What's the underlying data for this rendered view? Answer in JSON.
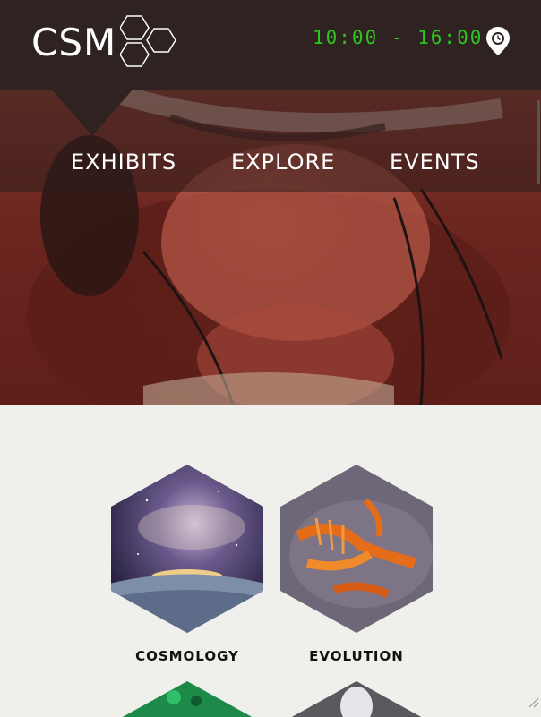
{
  "header": {
    "logo_text": "CSM",
    "hours": "10:00 - 16:00",
    "location_icon": "location-pin-clock-icon"
  },
  "nav": {
    "items": [
      "EXHIBITS",
      "EXPLORE",
      "EVENTS"
    ]
  },
  "exhibits": {
    "tiles": [
      {
        "label": "COSMOLOGY",
        "image": "nebula-over-earth"
      },
      {
        "label": "EVOLUTION",
        "image": "fossil-skeleton"
      },
      {
        "label": "",
        "image": "green-crystals"
      },
      {
        "label": "",
        "image": "robot-head"
      }
    ]
  },
  "colors": {
    "header_bg": "#2f2322",
    "hours_green": "#2ec41f",
    "content_bg": "#efefec"
  }
}
